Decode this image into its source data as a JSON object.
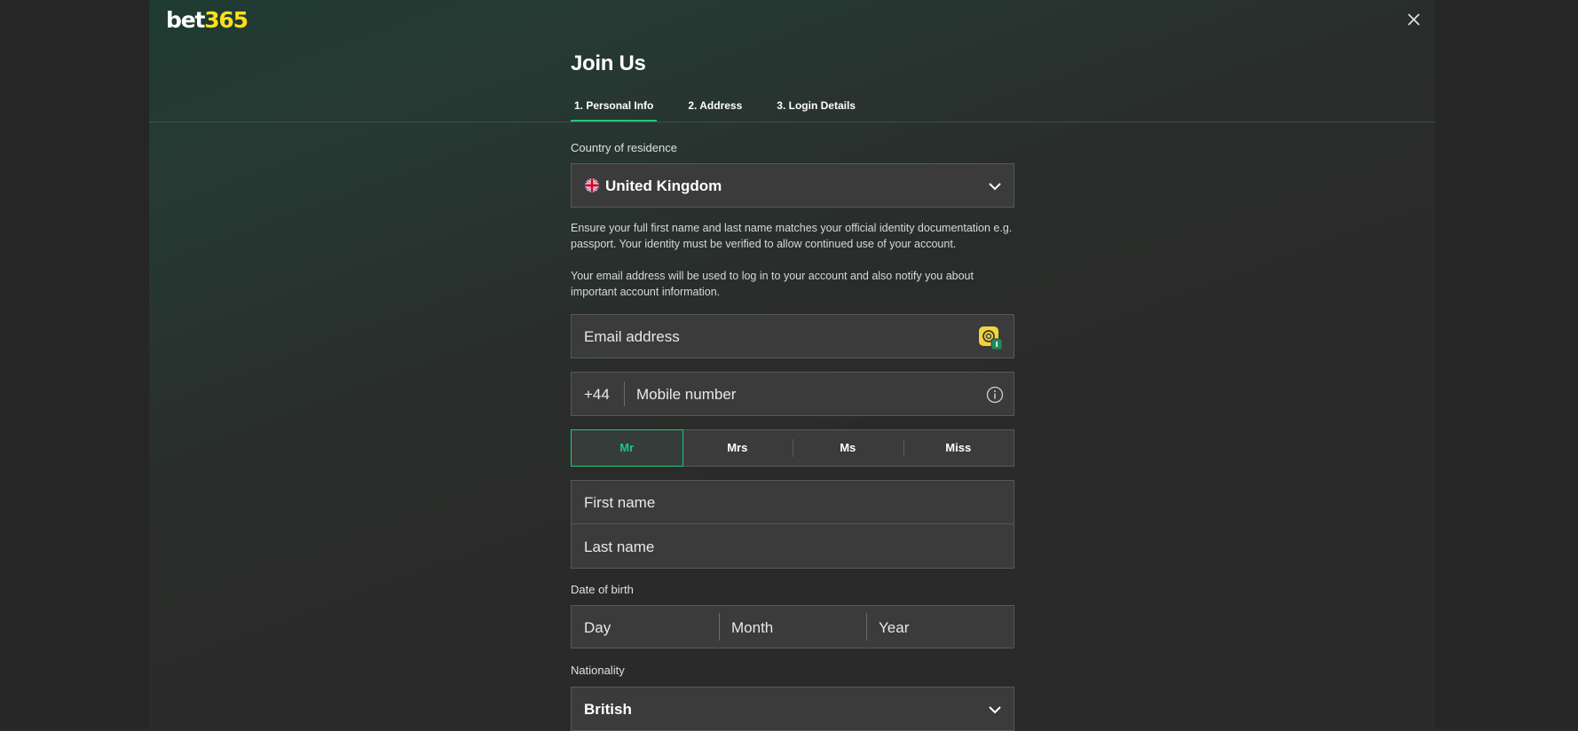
{
  "brand": {
    "logo_white": "bet",
    "logo_yellow": "365"
  },
  "header": {
    "title": "Join Us"
  },
  "tabs": [
    {
      "label": "1.  Personal Info",
      "active": true
    },
    {
      "label": "2.  Address",
      "active": false
    },
    {
      "label": "3.  Login Details",
      "active": false
    }
  ],
  "country": {
    "label": "Country of residence",
    "value": "United Kingdom",
    "flag_icon": "uk-flag-icon"
  },
  "notices": {
    "identity": "Ensure your full first name and last name matches your official identity documentation e.g. passport. Your identity must be verified to allow continued use of your account.",
    "email": "Your email address will be used to log in to your account and also notify you about important account information."
  },
  "email": {
    "placeholder": "Email address"
  },
  "mobile": {
    "prefix": "+44",
    "placeholder": "Mobile number"
  },
  "title_options": [
    {
      "label": "Mr",
      "selected": true
    },
    {
      "label": "Mrs",
      "selected": false
    },
    {
      "label": "Ms",
      "selected": false
    },
    {
      "label": "Miss",
      "selected": false
    }
  ],
  "name": {
    "first_placeholder": "First name",
    "last_placeholder": "Last name"
  },
  "dob": {
    "label": "Date of birth",
    "day": "Day",
    "month": "Month",
    "year": "Year"
  },
  "nationality": {
    "label": "Nationality",
    "value": "British"
  },
  "colors": {
    "accent": "#1ec87d",
    "brand_yellow": "#ffdf1b",
    "background": "#2a2a2a",
    "field_bg": "#3b3b3b"
  }
}
